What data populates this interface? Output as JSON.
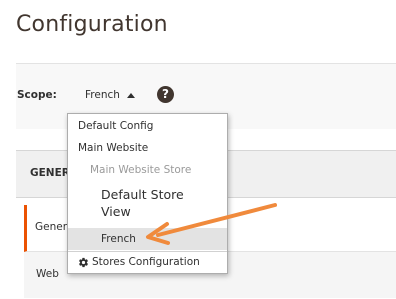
{
  "page": {
    "title": "Configuration"
  },
  "scope": {
    "label": "Scope:",
    "current": "French",
    "help_symbol": "?"
  },
  "panel": {
    "header_label": "GENER",
    "nav": {
      "general_label": "Gener",
      "web_label": "Web"
    }
  },
  "dropdown": {
    "default_config": "Default Config",
    "main_website": "Main Website",
    "main_website_store": "Main Website Store",
    "default_store_view": "Default Store View",
    "french": "French",
    "stores_configuration": "Stores Configuration"
  },
  "colors": {
    "accent": "#eb5202",
    "annotation_arrow": "#f08a3c",
    "selected_row": "#e3e3e3"
  },
  "icons": {
    "scope_arrow": "triangle-up-icon",
    "help": "question-circle-icon",
    "stores_config": "gear-icon",
    "annotation": "arrow-left-icon"
  }
}
